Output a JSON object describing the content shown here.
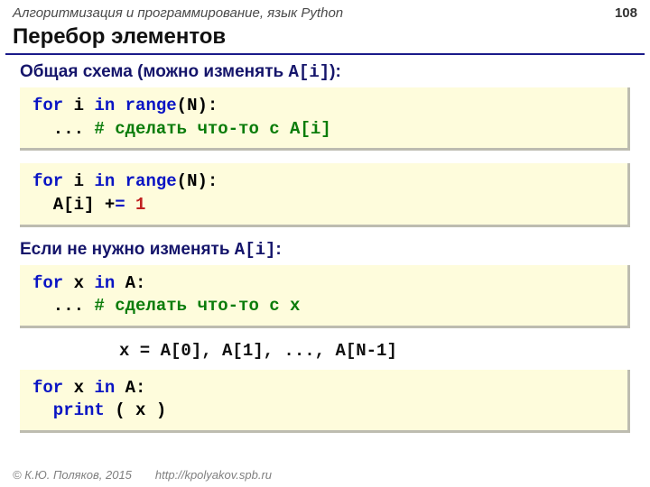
{
  "header": {
    "course": "Алгоритмизация и программирование, язык Python",
    "page": "108"
  },
  "title": "Перебор элементов",
  "section1": {
    "heading_pre": "Общая схема (можно изменять ",
    "heading_code": "A[i]",
    "heading_post": "):",
    "code1": {
      "l1a": "for",
      "l1b": " i ",
      "l1c": "in",
      "l1d": " range",
      "l1e": "(N):",
      "l2a": "  ... ",
      "l2b": "# сделать что-то c A[i]"
    },
    "code2": {
      "l1a": "for",
      "l1b": " i ",
      "l1c": "in",
      "l1d": " range",
      "l1e": "(N):",
      "l2a": "  A[i] +",
      "l2b": "=",
      "l2c": " 1"
    }
  },
  "section2": {
    "heading_pre": "Если не нужно изменять ",
    "heading_code": "A[i]",
    "heading_post": ":",
    "code3": {
      "l1a": "for",
      "l1b": " x ",
      "l1c": "in",
      "l1d": " A:",
      "l2a": "  ... ",
      "l2b": "# сделать что-то c x"
    },
    "note": "x = A[0], A[1], ..., A[N-1]",
    "code4": {
      "l1a": "for",
      "l1b": " x ",
      "l1c": "in",
      "l1d": " A:",
      "l2a": "  print",
      "l2b": " ( x )"
    }
  },
  "footer": {
    "copyright": "© К.Ю. Поляков, 2015",
    "url": "http://kpolyakov.spb.ru"
  }
}
